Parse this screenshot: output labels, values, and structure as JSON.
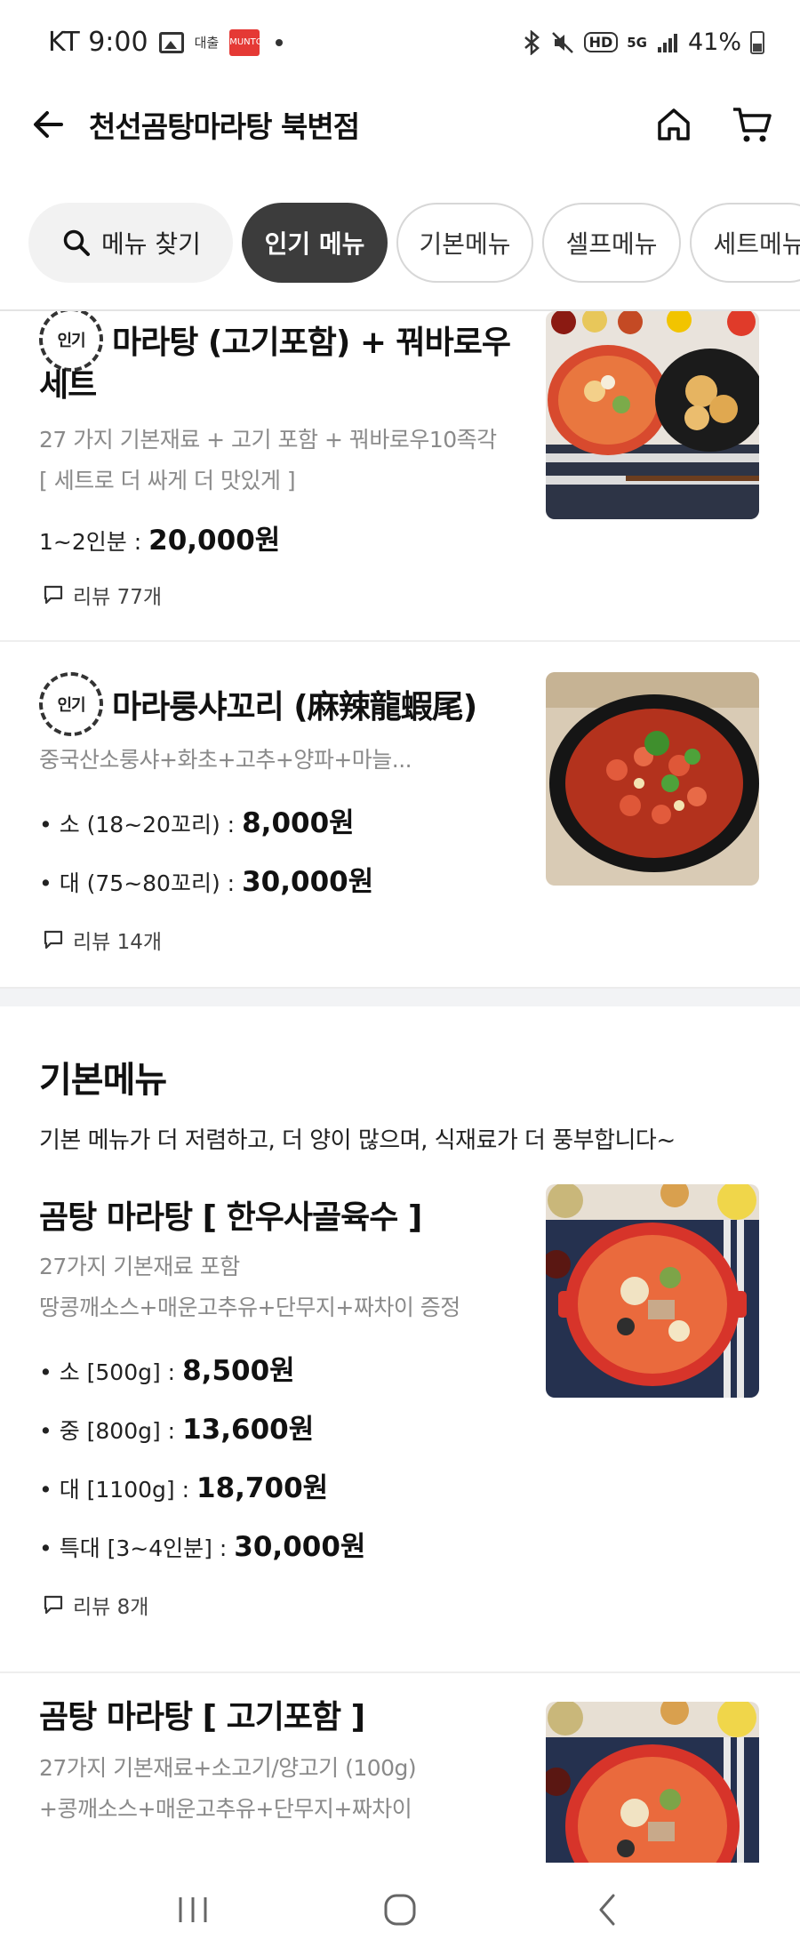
{
  "status_bar": {
    "carrier_time": "KT 9:00",
    "app_icon_text": "대출",
    "badge_text": "MUNTO",
    "hd": "HD",
    "net": "5G",
    "battery": "41%"
  },
  "header": {
    "title": "천선곰탕마라탕 북변점"
  },
  "tabs": {
    "search_label": "메뉴 찾기",
    "items": [
      "인기 메뉴",
      "기본메뉴",
      "셀프메뉴",
      "세트메뉴"
    ]
  },
  "badge_label": "인기",
  "popular": [
    {
      "title_line1": "마라탕 (고기포함) + 꿔바로우",
      "title_line2": "세트",
      "desc_line1": "27 가지 기본재료 + 고기 포함 + 꿔바로우10족각",
      "desc_line2": "[ 세트로 더 싸게 더 맛있게 ]",
      "prices": [
        {
          "label": "1~2인분 :",
          "value": "20,000원"
        }
      ],
      "review": "리뷰 77개"
    },
    {
      "title_line1": "마라룽샤꼬리 (麻辣龍蝦尾)",
      "desc_line1": "중국산소룽샤+화초+고추+양파+마늘...",
      "prices": [
        {
          "label": "• 소 (18~20꼬리) :",
          "value": "8,000원"
        },
        {
          "label": "• 대 (75~80꼬리) :",
          "value": "30,000원"
        }
      ],
      "review": "리뷰 14개"
    }
  ],
  "basic_section": {
    "title": "기본메뉴",
    "desc": "기본 메뉴가 더 저렴하고, 더 양이 많으며, 식재료가 더 풍부합니다~",
    "items": [
      {
        "title": "곰탕 마라탕 [ 한우사골육수 ]",
        "desc_line1": "27가지 기본재료 포함",
        "desc_line2": "땅콩깨소스+매운고추유+단무지+짜차이 증정",
        "prices": [
          {
            "label": "• 소 [500g] :",
            "value": "8,500원"
          },
          {
            "label": "• 중 [800g] :",
            "value": "13,600원"
          },
          {
            "label": "• 대 [1100g] :",
            "value": "18,700원"
          },
          {
            "label": "• 특대 [3~4인분] :",
            "value": "30,000원"
          }
        ],
        "review": "리뷰 8개"
      },
      {
        "title": "곰탕 마라탕 [ 고기포함 ]",
        "desc_line1": "27가지 기본재료+소고기/양고기 (100g)",
        "desc_line2": "+콩깨소스+매운고추유+단무지+짜차이"
      }
    ]
  },
  "icons": {
    "back": "back-arrow-icon",
    "home": "home-icon",
    "cart": "cart-icon",
    "search": "search-icon",
    "review": "speech-bubble-icon",
    "nav_recent": "recent-apps-icon",
    "nav_home": "home-circle-icon",
    "nav_back": "chevron-left-icon"
  },
  "colors": {
    "active_tab": "#3c3c3c",
    "muted_text": "#8a8a8a",
    "divider": "#eeeeee"
  }
}
